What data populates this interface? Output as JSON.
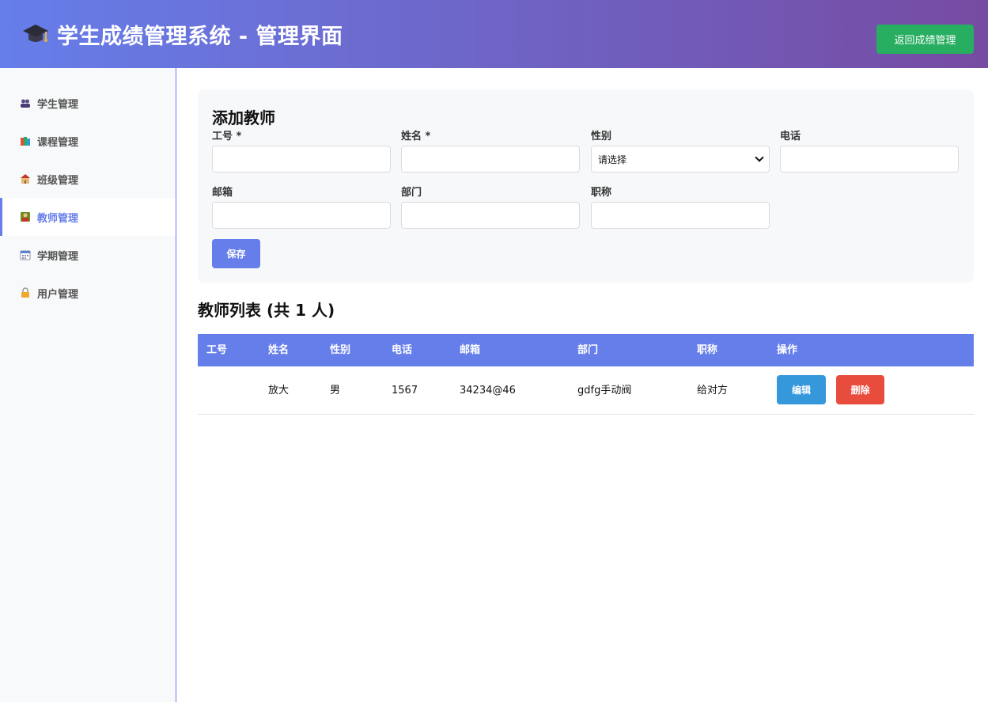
{
  "header": {
    "title": "学生成绩管理系统 - 管理界面",
    "back_label": "返回成绩管理",
    "icon": "graduation-cap-icon"
  },
  "sidebar": {
    "items": [
      {
        "label": "学生管理",
        "icon": "users-icon",
        "active": false
      },
      {
        "label": "课程管理",
        "icon": "books-icon",
        "active": false
      },
      {
        "label": "班级管理",
        "icon": "school-icon",
        "active": false
      },
      {
        "label": "教师管理",
        "icon": "teacher-icon",
        "active": true
      },
      {
        "label": "学期管理",
        "icon": "calendar-icon",
        "active": false
      },
      {
        "label": "用户管理",
        "icon": "lock-icon",
        "active": false
      }
    ]
  },
  "form": {
    "title": "添加教师",
    "fields": {
      "id": {
        "label": "工号 *",
        "value": ""
      },
      "name": {
        "label": "姓名 *",
        "value": ""
      },
      "gender": {
        "label": "性别",
        "value": "请选择"
      },
      "phone": {
        "label": "电话",
        "value": ""
      },
      "email": {
        "label": "邮箱",
        "value": ""
      },
      "dept": {
        "label": "部门",
        "value": ""
      },
      "rank": {
        "label": "职称",
        "value": ""
      }
    },
    "save_label": "保存"
  },
  "list": {
    "title": "教师列表 (共 1 人)",
    "columns": [
      "工号",
      "姓名",
      "性别",
      "电话",
      "邮箱",
      "部门",
      "职称",
      "操作"
    ],
    "rows": [
      {
        "id": "",
        "name": "放大",
        "gender": "男",
        "phone": "1567",
        "email": "34234@46",
        "dept": "gdfg手动阀",
        "rank": "给对方"
      }
    ],
    "edit_label": "编辑",
    "delete_label": "删除"
  },
  "colors": {
    "primary": "#667eea",
    "header_gradient_end": "#764ba2",
    "back_button": "#27ae60",
    "edit_button": "#3498db",
    "delete_button": "#e74c3c"
  }
}
